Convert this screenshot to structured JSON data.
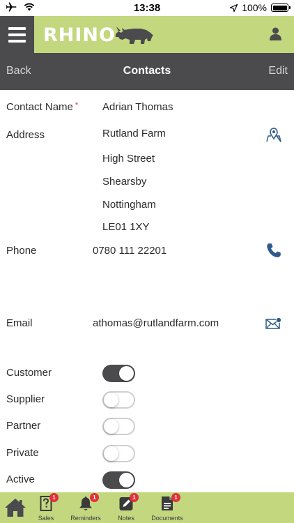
{
  "status_bar": {
    "time": "13:38",
    "battery": "100%"
  },
  "app": {
    "logo_text": "RHINO"
  },
  "nav": {
    "back": "Back",
    "title": "Contacts",
    "edit": "Edit"
  },
  "contact": {
    "name_label": "Contact Name",
    "required_mark": "*",
    "name_value": "Adrian Thomas",
    "address_label": "Address",
    "address_lines": [
      "Rutland Farm",
      "High Street",
      "Shearsby",
      "Nottingham",
      "LE01 1XY"
    ],
    "phone_label": "Phone",
    "phone_value": "0780 111 22201",
    "email_label": "Email",
    "email_value": "athomas@rutlandfarm.com"
  },
  "toggles": [
    {
      "label": "Customer",
      "on": true
    },
    {
      "label": "Supplier",
      "on": false
    },
    {
      "label": "Partner",
      "on": false
    },
    {
      "label": "Private",
      "on": false
    },
    {
      "label": "Active",
      "on": true
    }
  ],
  "tab_bar": {
    "home_icon": "home-icon",
    "tabs": [
      {
        "label": "Sales",
        "badge": "1",
        "icon": "question-doc-icon"
      },
      {
        "label": "Reminders",
        "badge": "1",
        "icon": "bell-icon"
      },
      {
        "label": "Notes",
        "badge": "1",
        "icon": "pencil-note-icon"
      },
      {
        "label": "Documents",
        "badge": "1",
        "icon": "document-icon"
      }
    ]
  },
  "colors": {
    "accent_green": "#c3d77f",
    "dark_bar": "#4b4b4e",
    "link_blue": "#2e5b8a",
    "badge_red": "#e0303a"
  }
}
